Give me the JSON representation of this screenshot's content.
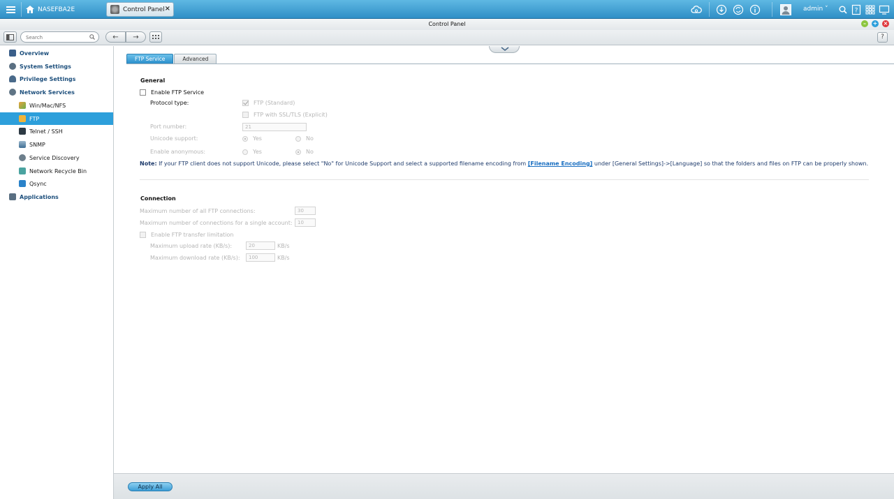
{
  "taskbar": {
    "home_label": "NASEFBA2E",
    "window_tab_label": "Control Panel",
    "close_glyph": "×",
    "user_label": "admin",
    "icons": [
      "cloud-icon",
      "download-icon",
      "sync-icon",
      "info-icon",
      "user-avatar-icon",
      "search-icon",
      "help-icon",
      "apps-grid-icon",
      "monitor-icon"
    ]
  },
  "window": {
    "title": "Control Panel",
    "colors": {
      "minimize": "#8cc63f",
      "maximize": "#2d9fdb",
      "close": "#e0393e"
    }
  },
  "toolbar": {
    "search_placeholder": "Search",
    "help_label": "?"
  },
  "sidebar": {
    "items": [
      {
        "label": "Overview",
        "level": "top",
        "icon": "overview-icon"
      },
      {
        "label": "System Settings",
        "level": "top",
        "icon": "gear-icon"
      },
      {
        "label": "Privilege Settings",
        "level": "top",
        "icon": "user-icon"
      },
      {
        "label": "Network Services",
        "level": "top",
        "icon": "globe-icon"
      },
      {
        "label": "Win/Mac/NFS",
        "level": "sub",
        "icon": "network-share-icon"
      },
      {
        "label": "FTP",
        "level": "sub",
        "icon": "ftp-icon",
        "selected": true
      },
      {
        "label": "Telnet / SSH",
        "level": "sub",
        "icon": "terminal-icon"
      },
      {
        "label": "SNMP",
        "level": "sub",
        "icon": "snmp-icon"
      },
      {
        "label": "Service Discovery",
        "level": "sub",
        "icon": "service-discovery-icon"
      },
      {
        "label": "Network Recycle Bin",
        "level": "sub",
        "icon": "recycle-bin-icon"
      },
      {
        "label": "Qsync",
        "level": "sub",
        "icon": "qsync-icon"
      },
      {
        "label": "Applications",
        "level": "top",
        "icon": "applications-icon"
      }
    ]
  },
  "tabs": [
    {
      "label": "FTP Service",
      "active": true
    },
    {
      "label": "Advanced",
      "active": false
    }
  ],
  "general": {
    "title": "General",
    "enable_ftp": "Enable FTP Service",
    "protocol_type_label": "Protocol type:",
    "ftp_standard": "FTP (Standard)",
    "ftp_ssl": "FTP with SSL/TLS (Explicit)",
    "port_label": "Port number:",
    "port_value": "21",
    "unicode_label": "Unicode support:",
    "anonymous_label": "Enable anonymous:",
    "yes": "Yes",
    "no": "No",
    "note_prefix": "Note:",
    "note_text_1": " If your FTP client does not support Unicode, please select \"No\" for Unicode Support and select a supported filename encoding from ",
    "note_link": "[Filename Encoding]",
    "note_text_2": " under [General Settings]->[Language] so that the folders and files on FTP can be properly shown."
  },
  "connection": {
    "title": "Connection",
    "max_all_label": "Maximum number of all FTP connections:",
    "max_all_value": "30",
    "max_single_label": "Maximum number of connections for a single account:",
    "max_single_value": "10",
    "enable_limit": "Enable FTP transfer limitation",
    "upload_label": "Maximum upload rate (KB/s):",
    "upload_value": "20",
    "download_label": "Maximum download rate (KB/s):",
    "download_value": "100",
    "unit": "KB/s"
  },
  "footer": {
    "apply_label": "Apply All"
  }
}
